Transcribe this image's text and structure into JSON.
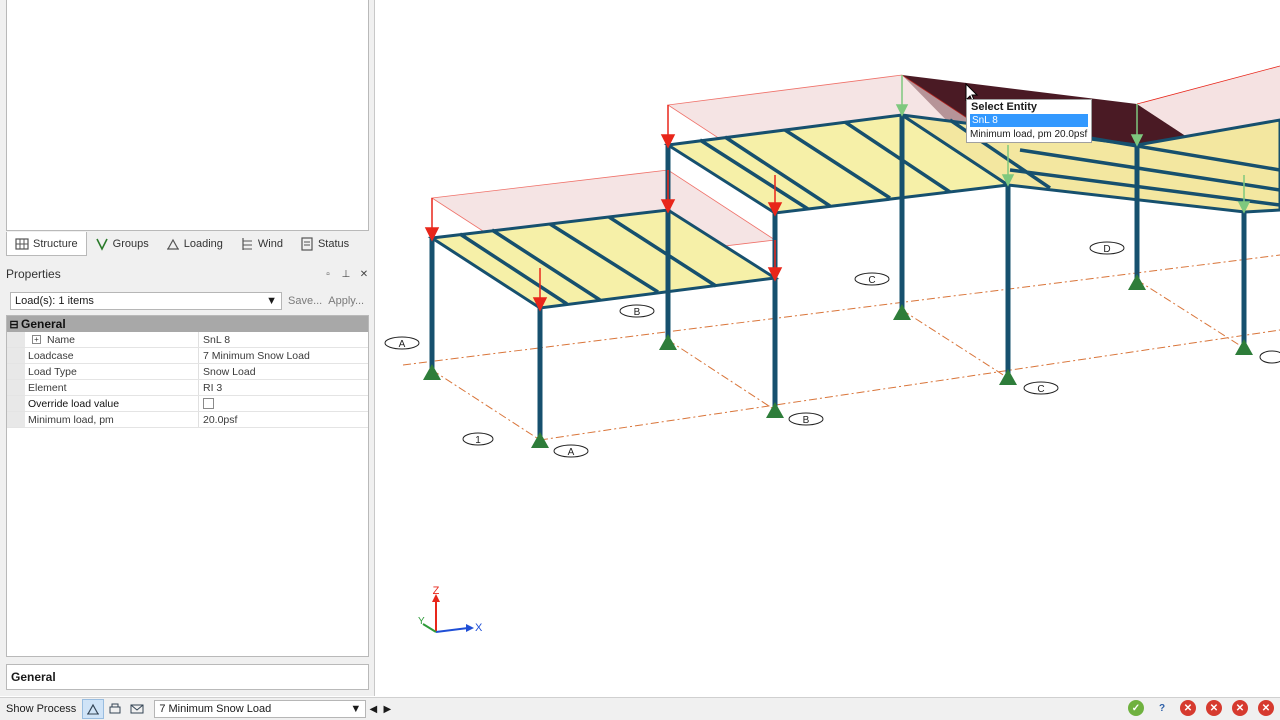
{
  "left_tabs": [
    {
      "label": "Structure",
      "icon": "structure-icon"
    },
    {
      "label": "Groups",
      "icon": "groups-icon"
    },
    {
      "label": "Loading",
      "icon": "loading-icon"
    },
    {
      "label": "Wind",
      "icon": "wind-icon"
    },
    {
      "label": "Status",
      "icon": "status-icon"
    }
  ],
  "properties": {
    "title": "Properties",
    "selection": "Load(s): 1 items",
    "save_label": "Save...",
    "apply_label": "Apply...",
    "category": "General",
    "rows": [
      {
        "name": "Name",
        "value": "SnL 8"
      },
      {
        "name": "Loadcase",
        "value": "7 Minimum Snow Load"
      },
      {
        "name": "Load Type",
        "value": "Snow Load"
      },
      {
        "name": "Element",
        "value": "RI 3"
      },
      {
        "name": "Override load value",
        "value": ""
      },
      {
        "name": "Minimum load, pm",
        "value": "20.0psf"
      }
    ],
    "description_title": "General"
  },
  "status_bar": {
    "show_process": "Show Process",
    "loadcase": "7 Minimum Snow Load"
  },
  "tooltip": {
    "title": "Select Entity",
    "selected": "SnL 8",
    "description": "Minimum load, pm 20.0psf"
  },
  "grid_labels": {
    "a1": "A",
    "a2": "A",
    "a3": "A",
    "b1": "B",
    "b2": "B",
    "c1": "C",
    "c2": "C",
    "d1": "D",
    "n1": "1"
  },
  "axes": {
    "z": "Z",
    "x": "X",
    "y": "Y"
  },
  "colors": {
    "steel": "#16506e",
    "roof_fill": "#f6f0a8",
    "load_arrow": "#e8261a",
    "support": "#2e7d3a",
    "gridline": "#d9753a",
    "selected_load": "#4a1a24"
  }
}
